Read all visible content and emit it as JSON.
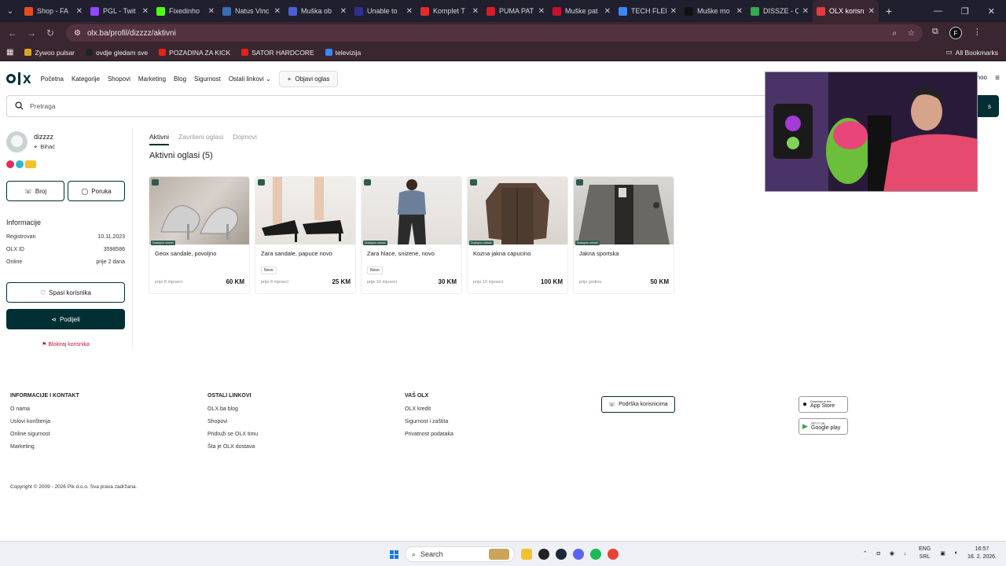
{
  "browser": {
    "tabs": [
      {
        "title": "Shop - FA",
        "color": "#e54d1f"
      },
      {
        "title": "PGL - Twit",
        "color": "#9146ff"
      },
      {
        "title": "Fixedinho",
        "color": "#53fc18"
      },
      {
        "title": "Natus Vinc",
        "color": "#3a6cb4"
      },
      {
        "title": "Muška ob",
        "color": "#4a5fd1"
      },
      {
        "title": "Unable to",
        "color": "#2f2f8f"
      },
      {
        "title": "Komplet T",
        "color": "#e32b2b"
      },
      {
        "title": "PUMA PAT",
        "color": "#d41e2a"
      },
      {
        "title": "Muške pat",
        "color": "#c8102e"
      },
      {
        "title": "TECH FLEE",
        "color": "#4285f4"
      },
      {
        "title": "Muške mo",
        "color": "#111111"
      },
      {
        "title": "DISSZE - C",
        "color": "#34a853"
      },
      {
        "title": "OLX korisn",
        "color": "#e33b3b",
        "active": true
      }
    ],
    "url": "olx.ba/profil/dizzzz/aktivni",
    "bookmarks": [
      {
        "label": "Zywoo pulsar",
        "color": "#d9a520"
      },
      {
        "label": "ovdje gledam sve",
        "color": "#222222"
      },
      {
        "label": "POZADINA ZA KICK",
        "color": "#e62117"
      },
      {
        "label": "SATOR HARDCORE",
        "color": "#e62117"
      },
      {
        "label": "televizija",
        "color": "#4285f4"
      }
    ],
    "all_bookmarks": "All Bookmarks"
  },
  "header": {
    "nav": [
      "Početna",
      "Kategorije",
      "Shopovi",
      "Marketing",
      "Blog",
      "Sigurnost",
      "Ostali linkovi"
    ],
    "publish": "Objavi oglas",
    "user_fragment": "hoo",
    "search_placeholder": "Pretraga",
    "search_button": "s"
  },
  "profile": {
    "username": "dizzzz",
    "location": "Bihać",
    "call_label": "Broj",
    "message_label": "Poruka",
    "info_title": "Informacije",
    "info": [
      {
        "label": "Registrovan",
        "value": "10.11.2023"
      },
      {
        "label": "OLX ID",
        "value": "3598586"
      },
      {
        "label": "Online",
        "value": "prije 2 dana"
      }
    ],
    "save_label": "Spasi korisnika",
    "share_label": "Podijeli",
    "block_label": "Blokiraj korisnika"
  },
  "content": {
    "tabs": [
      "Aktivni",
      "Završeni oglasi",
      "Dojmovi"
    ],
    "title": "Aktivni oglasi (5)",
    "listings": [
      {
        "title": "Geox sandale, povoljno",
        "price": "60 KM",
        "age": "prije 8 mjeseci",
        "badge": "Dostupno odmah",
        "new": ""
      },
      {
        "title": "Zara sandale, papuce novo",
        "price": "25 KM",
        "age": "prije 8 mjeseci",
        "badge": "",
        "new": "Novo"
      },
      {
        "title": "Zara hlace, snizene, novo",
        "price": "30 KM",
        "age": "prije 10 mjeseci",
        "badge": "Dostupno odmah",
        "new": "Novo"
      },
      {
        "title": "Kozna jakna capucino",
        "price": "100 KM",
        "age": "prije 10 mjeseci",
        "badge": "Dostupno odmah",
        "new": ""
      },
      {
        "title": "Jakna sportska",
        "price": "50 KM",
        "age": "prije godinu",
        "badge": "Dostupno odmah",
        "new": ""
      }
    ]
  },
  "footer": {
    "col1": {
      "heading": "INFORMACIJE I KONTAKT",
      "links": [
        "O nama",
        "Uslovi korištenja",
        "Online sigurnost",
        "Marketing"
      ]
    },
    "col2": {
      "heading": "OSTALI LINKOVI",
      "links": [
        "OLX.ba blog",
        "Shopovi",
        "Pridruži se OLX timu",
        "Šta je OLX dostava"
      ]
    },
    "col3": {
      "heading": "VAŠ OLX",
      "links": [
        "OLX kredit",
        "Sigurnost i zaštita",
        "Privatnost podataka"
      ]
    },
    "support": "Podrška korisnicima",
    "appstore_small": "Download on the",
    "appstore": "App Store",
    "googleplay_small": "GET IT ON",
    "googleplay": "Google play",
    "copyright": "Copyright © 2009 - 2026 Pik d.o.o. Sva prava zadržana."
  },
  "taskbar": {
    "search": "Search",
    "lang_top": "ENG",
    "lang_bottom": "SRL",
    "time": "16:57",
    "date": "18. 2. 2026."
  }
}
